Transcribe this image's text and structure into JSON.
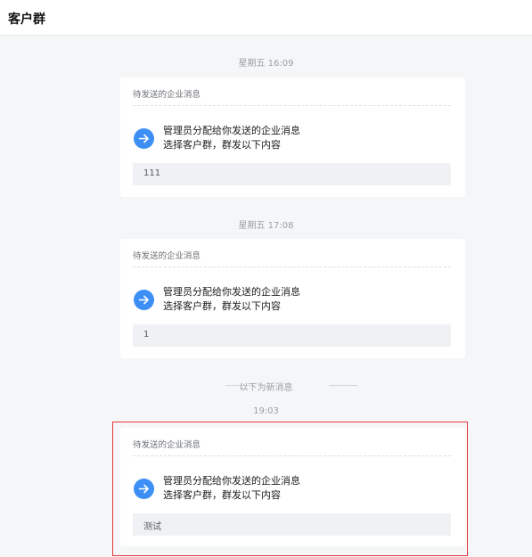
{
  "header": {
    "title": "客户群"
  },
  "messages": [
    {
      "time": "星期五 16:09",
      "card_title": "待发送的企业消息",
      "line1": "管理员分配给你发送的企业消息",
      "line2": "选择客户群，群发以下内容",
      "content": "111"
    },
    {
      "time": "星期五 17:08",
      "card_title": "待发送的企业消息",
      "line1": "管理员分配给你发送的企业消息",
      "line2": "选择客户群，群发以下内容",
      "content": "1"
    },
    {
      "time": "19:03",
      "card_title": "待发送的企业消息",
      "line1": "管理员分配给你发送的企业消息",
      "line2": "选择客户群，群发以下内容",
      "content": "测试"
    }
  ],
  "new_messages_divider": "以下为新消息",
  "icons": {
    "send": "arrow-right-icon"
  },
  "colors": {
    "accent": "#3d8ff5",
    "highlight_border": "#e4393c",
    "content_box": "#eff1f4"
  }
}
